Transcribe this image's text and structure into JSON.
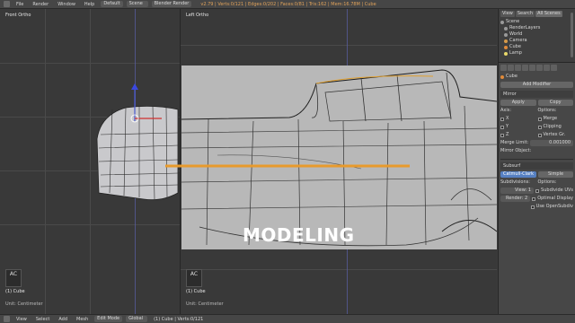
{
  "topbar": {
    "menus": [
      "File",
      "Render",
      "Window",
      "Help"
    ],
    "layout": "Default",
    "scene": "Scene",
    "engine": "Blender Render",
    "stats": "v2.79 | Verts:0/121 | Edges:0/202 | Faces:0/81 | Tris:162 | Mem:16.78M | Cube"
  },
  "viewports": {
    "left": {
      "label": "Front Ortho",
      "object": "(1) Cube",
      "units": "Unit: Centimeter"
    },
    "right": {
      "label": "Left Ortho",
      "object": "(1) Cube",
      "units": "Unit: Centimeter"
    }
  },
  "gizmo_text": "AC",
  "caption": "MODELING",
  "outliner": {
    "tabs": [
      "View",
      "Search",
      "All Scenes"
    ],
    "items": [
      {
        "label": "Scene",
        "type": "scene"
      },
      {
        "label": "RenderLayers",
        "type": "layer"
      },
      {
        "label": "World",
        "type": "world"
      },
      {
        "label": "Camera",
        "type": "cam"
      },
      {
        "label": "Cube",
        "type": "mesh"
      },
      {
        "label": "Lamp",
        "type": "lamp"
      }
    ]
  },
  "properties": {
    "object": "Cube",
    "modifier_add": "Add Modifier",
    "modifier_name": "Mirror",
    "apply": "Apply",
    "copy": "Copy",
    "axis_label": "Axis:",
    "options_label": "Options:",
    "axes": [
      "X",
      "Y",
      "Z"
    ],
    "options": [
      "Merge",
      "Clipping",
      "Vertex Gr."
    ],
    "merge_limit_label": "Merge Limit:",
    "merge_limit_value": "0.001000",
    "mirror_object_label": "Mirror Object:",
    "subsurf_name": "Subsurf",
    "catmull": "Catmull-Clark",
    "simple": "Simple",
    "subdivisions": "Subdivisions:",
    "view_label": "View:",
    "view_value": "1",
    "render_label": "Render:",
    "render_value": "2",
    "sub_options": "Options:",
    "subdivide_uvs": "Subdivide UVs",
    "optimal_display": "Optimal Display",
    "use_opensubdiv": "Use OpenSubdiv"
  },
  "bottombar": {
    "mode": "Edit Mode",
    "pivot": "Global",
    "menus": [
      "View",
      "Select",
      "Add",
      "Mesh"
    ],
    "info": "(1) Cube | Verts:0/121"
  }
}
